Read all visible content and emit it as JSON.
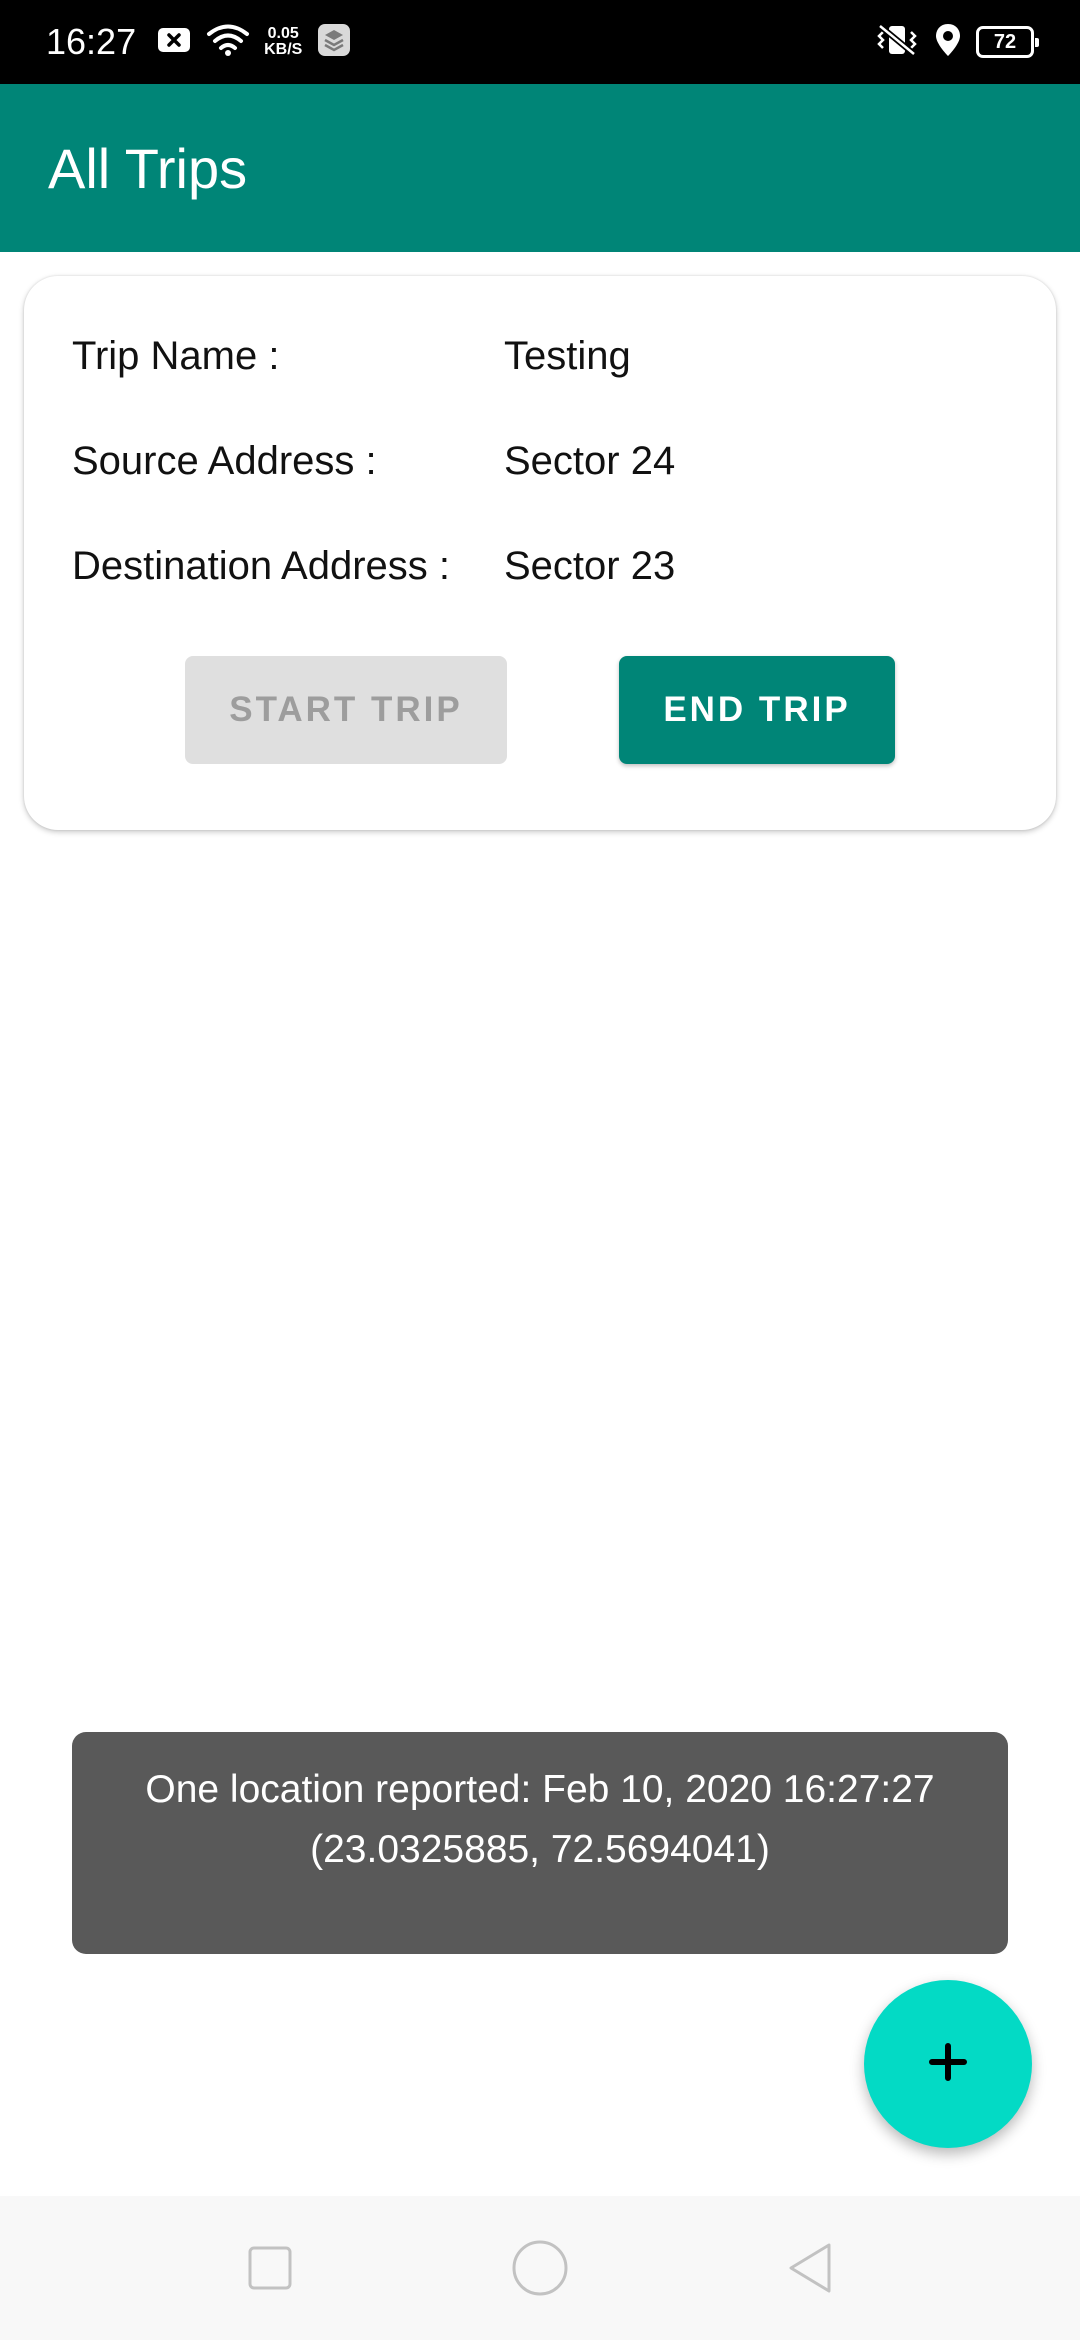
{
  "status_bar": {
    "time": "16:27",
    "net_speed_value": "0.05",
    "net_speed_unit": "KB/S",
    "battery": "72",
    "icons": [
      "notification-x-icon",
      "wifi-icon",
      "app-stack-icon",
      "vibrate-icon",
      "location-icon",
      "battery-icon"
    ]
  },
  "app_bar": {
    "title": "All Trips"
  },
  "trip": {
    "name_label": "Trip Name :",
    "name_value": "Testing",
    "source_label": "Source Address :",
    "source_value": "Sector 24",
    "destination_label": "Destination Address :",
    "destination_value": "Sector 23",
    "start_button": "START TRIP",
    "end_button": "END TRIP"
  },
  "toast": {
    "line1": "One location reported: Feb 10, 2020 16:27:27",
    "line2": "(23.0325885, 72.5694041)"
  },
  "fab": {
    "icon": "plus-icon"
  },
  "nav_bar": {
    "icons": [
      "recents-icon",
      "home-icon",
      "back-icon"
    ]
  },
  "colors": {
    "primary": "#008577",
    "accent": "#03dac5",
    "toast_bg": "#595959",
    "disabled_button": "#dfdfdf"
  }
}
